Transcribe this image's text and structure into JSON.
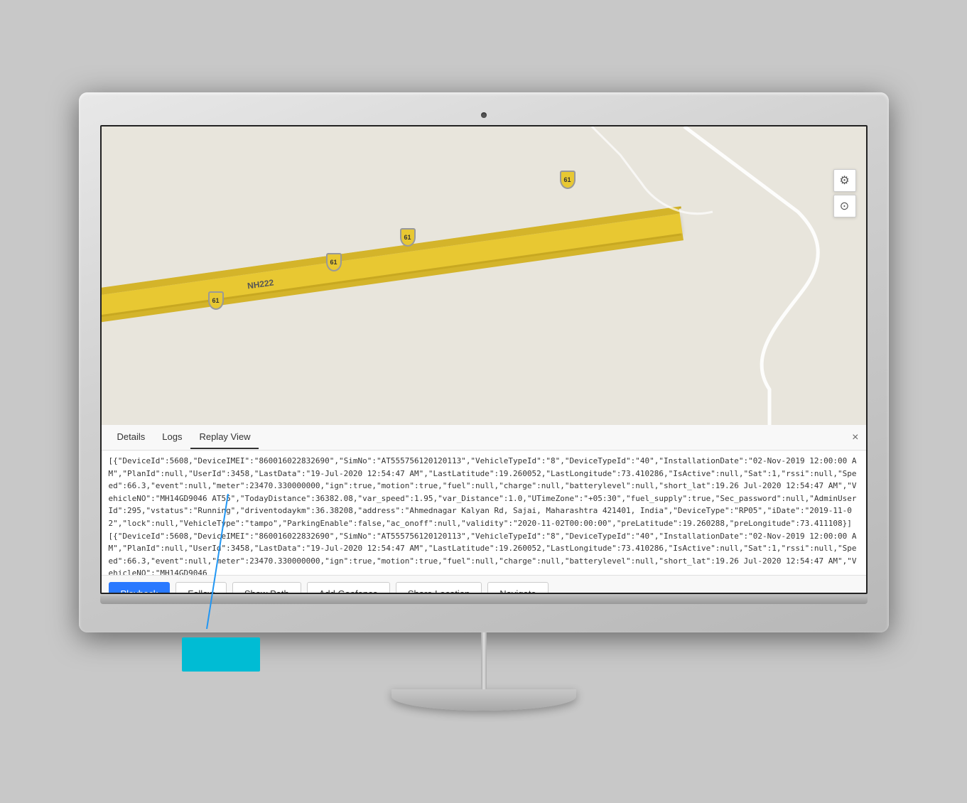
{
  "monitor": {
    "camera_label": "camera"
  },
  "map": {
    "road_label": "NH222",
    "shield_labels": [
      "61",
      "61",
      "61",
      "61"
    ],
    "controls": {
      "settings_icon": "⚙",
      "target_icon": "⊙"
    }
  },
  "tabs": {
    "items": [
      {
        "label": "Details",
        "active": false
      },
      {
        "label": "Logs",
        "active": false
      },
      {
        "label": "Replay View",
        "active": true
      }
    ],
    "close_label": "×"
  },
  "log_content": "[{\"DeviceId\":5608,\"DeviceIMEI\":\"860016022832690\",\"SimNo\":\"AT555756120120113\",\"VehicleTypeId\":\"8\",\"DeviceTypeId\":\"40\",\"InstallationDate\":\"02-Nov-2019 12:00:00 AM\",\"PlanId\":null,\"UserId\":3458,\"LastData\":\"19-Jul-2020 12:54:47 AM\",\"LastLatitude\":19.260052,\"LastLongitude\":73.410286,\"IsActive\":null,\"Sat\":1,\"rssi\":null,\"Speed\":66.3,\"event\":null,\"meter\":23470.330000000,\"ign\":true,\"motion\":true,\"fuel\":null,\"charge\":null,\"batterylevel\":null,\"short_lat\":19.26 Jul-2020 12:54:47 AM\",\"VehicleNO\":\"MH14GD9046 AT55\",\"TodayDistance\":36382.08,\"var_speed\":1.95,\"var_Distance\":1.0,\"UTimeZone\":\"+05:30\",\"fuel_supply\":true,\"Sec_password\":null,\"AdminUserId\":295,\"vstatus\":\"Running\",\"driventodaykm\":36.38208,\"address\":\"Ahmednagar Kalyan Rd, Sajai, Maharashtra 421401, India\",\"DeviceType\":\"RP05\",\"iDate\":\"2019-11-02\",\"lock\":null,\"VehicleType\":\"tampo\",\"ParkingEnable\":false,\"ac_onoff\":null,\"validity\":\"2020-11-02T00:00:00\",\"preLatitude\":19.260288,\"preLongitude\":73.411108}][{\"DeviceId\":5608,\"DeviceIMEI\":\"860016022832690\",\"SimNo\":\"AT555756120120113\",\"VehicleTypeId\":\"8\",\"DeviceTypeId\":\"40\",\"InstallationDate\":\"02-Nov-2019 12:00:00 AM\",\"PlanId\":null,\"UserId\":3458,\"LastData\":\"19-Jul-2020 12:54:47 AM\",\"LastLatitude\":19.260052,\"LastLongitude\":73.410286,\"IsActive\":null,\"Sat\":1,\"rssi\":null,\"Speed\":66.3,\"event\":null,\"meter\":23470.330000000,\"ign\":true,\"motion\":true,\"fuel\":null,\"charge\":null,\"batterylevel\":null,\"short_lat\":19.26 Jul-2020 12:54:47 AM\",\"VehicleNO\":\"MH14GD9046",
  "actions": {
    "playback_label": "Playback",
    "follow_label": "Follow",
    "show_path_label": "Show Path",
    "add_geofence_label": "Add Geofence",
    "share_location_label": "Share Location",
    "navigate_label": "Navigate"
  }
}
